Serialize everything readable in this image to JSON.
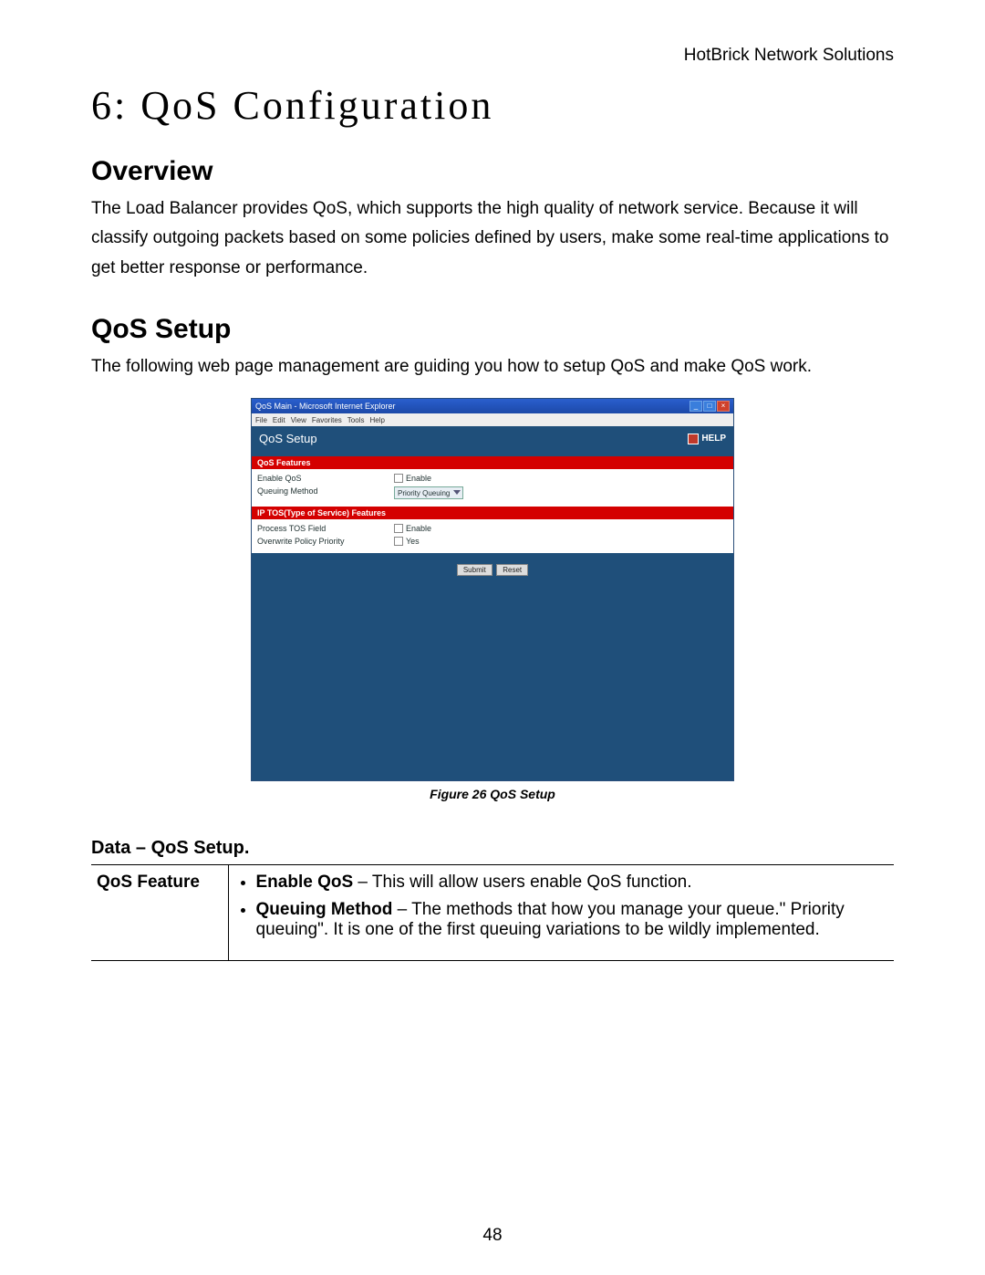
{
  "header": {
    "brand": "HotBrick Network Solutions"
  },
  "chapter": {
    "title": "6: QoS Configuration"
  },
  "sections": {
    "overview": {
      "heading": "Overview",
      "body": "The  Load Balancer provides QoS, which supports the high quality of network service. Because it will classify outgoing packets based on some policies defined by users, make some real-time applications to get better response or performance."
    },
    "setup": {
      "heading": "QoS Setup",
      "body": "The following web page management are guiding you how to setup QoS and make QoS work."
    }
  },
  "figure": {
    "window_title": "QoS Main - Microsoft Internet Explorer",
    "menubar": [
      "File",
      "Edit",
      "View",
      "Favorites",
      "Tools",
      "Help"
    ],
    "panel_title": "QoS Setup",
    "help_label": "HELP",
    "group1_title": "QoS Features",
    "group1_rows": [
      {
        "label": "Enable QoS",
        "option": "Enable"
      },
      {
        "label": "Queuing Method",
        "option": "Priority Queuing"
      }
    ],
    "group2_title": "IP TOS(Type of Service) Features",
    "group2_rows": [
      {
        "label": "Process TOS Field",
        "option": "Enable"
      },
      {
        "label": "Overwrite Policy Priority",
        "option": "Yes"
      }
    ],
    "buttons": {
      "submit": "Submit",
      "reset": "Reset"
    },
    "caption": "Figure 26 QoS Setup"
  },
  "data_table": {
    "heading": "Data – QoS Setup.",
    "col1": "QoS Feature",
    "items": [
      {
        "term": "Enable QoS",
        "desc": " – This will allow users enable QoS function."
      },
      {
        "term": "Queuing Method",
        "desc": " – The methods that how you manage your queue.\" Priority queuing\". It is one of the first queuing variations to be wildly implemented."
      }
    ]
  },
  "page_number": "48"
}
